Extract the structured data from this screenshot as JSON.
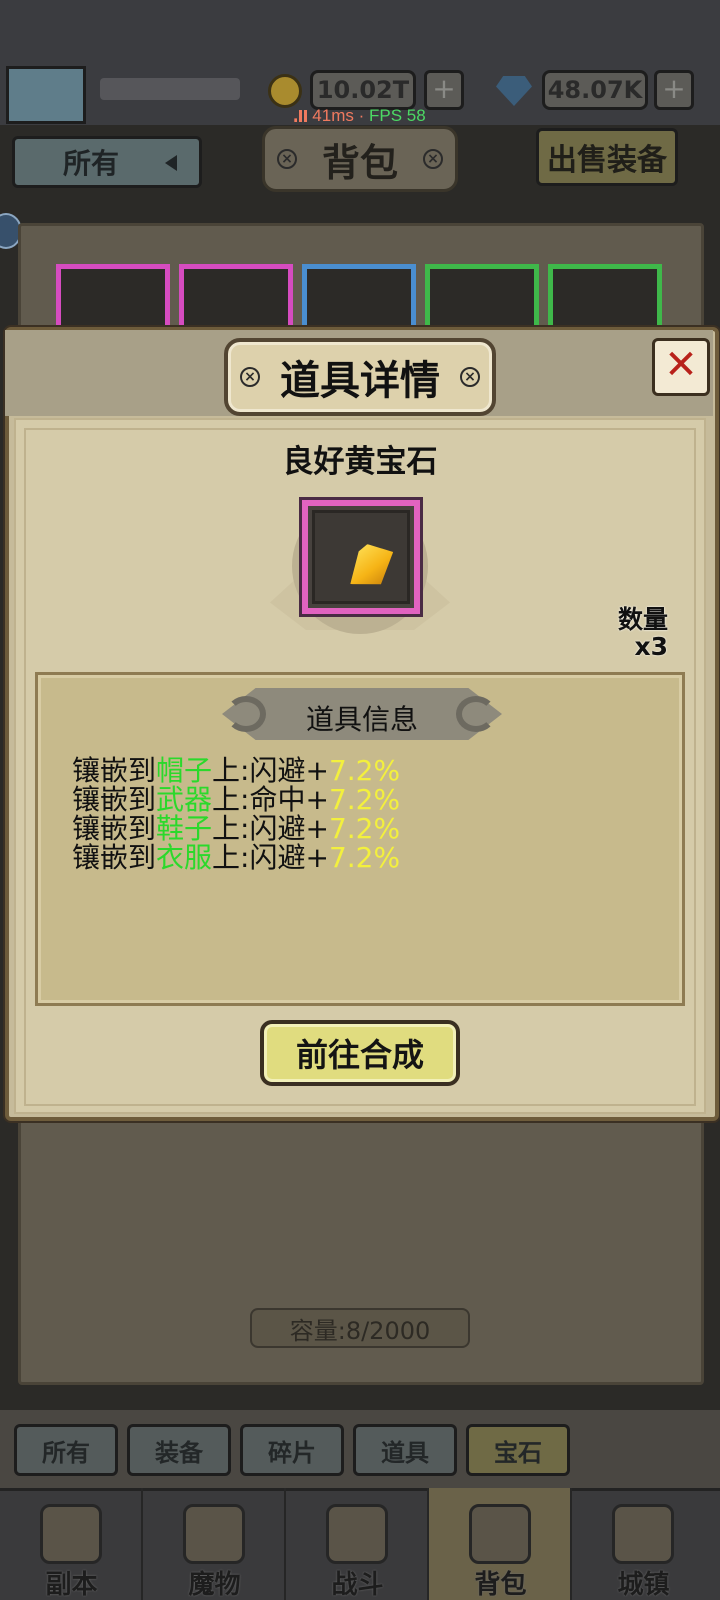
{
  "status": {
    "ping": "41ms",
    "separator": " · ",
    "fps": "FPS 58"
  },
  "header": {
    "gold": "10.02T",
    "gems": "48.07K",
    "plus": "+"
  },
  "bag": {
    "filter": "所有",
    "title": "背包",
    "sell_button": "出售装备",
    "capacity": "容量:8/2000",
    "slot_colors": [
      "#d64cc0",
      "#d64cc0",
      "#4a8ed0",
      "#3fb84a",
      "#3fb84a"
    ]
  },
  "tabs": [
    {
      "label": "所有"
    },
    {
      "label": "装备"
    },
    {
      "label": "碎片"
    },
    {
      "label": "道具"
    },
    {
      "label": "宝石"
    }
  ],
  "nav": [
    {
      "label": "副本",
      "icon": "map-icon"
    },
    {
      "label": "魔物",
      "icon": "monster-icon"
    },
    {
      "label": "战斗",
      "icon": "swords-icon"
    },
    {
      "label": "背包",
      "icon": "backpack-icon"
    },
    {
      "label": "城镇",
      "icon": "town-icon"
    }
  ],
  "modal": {
    "title": "道具详情",
    "close": "✕",
    "item_name": "良好黄宝石",
    "item_frame_color": "#e163c0",
    "quantity_label": "数量",
    "quantity_value": "x3",
    "info_title": "道具信息",
    "lines": [
      {
        "prefix": "镶嵌到",
        "slot": "帽子",
        "suffix": "上:闪避+",
        "value": "7.2%"
      },
      {
        "prefix": "镶嵌到",
        "slot": "武器",
        "suffix": "上:命中+",
        "value": "7.2%"
      },
      {
        "prefix": "镶嵌到",
        "slot": "鞋子",
        "suffix": "上:闪避+",
        "value": "7.2%"
      },
      {
        "prefix": "镶嵌到",
        "slot": "衣服",
        "suffix": "上:闪避+",
        "value": "7.2%"
      }
    ],
    "action_button": "前往合成"
  },
  "colors": {
    "slot_text": "#2bd92b",
    "value_text": "#f3f03d"
  }
}
